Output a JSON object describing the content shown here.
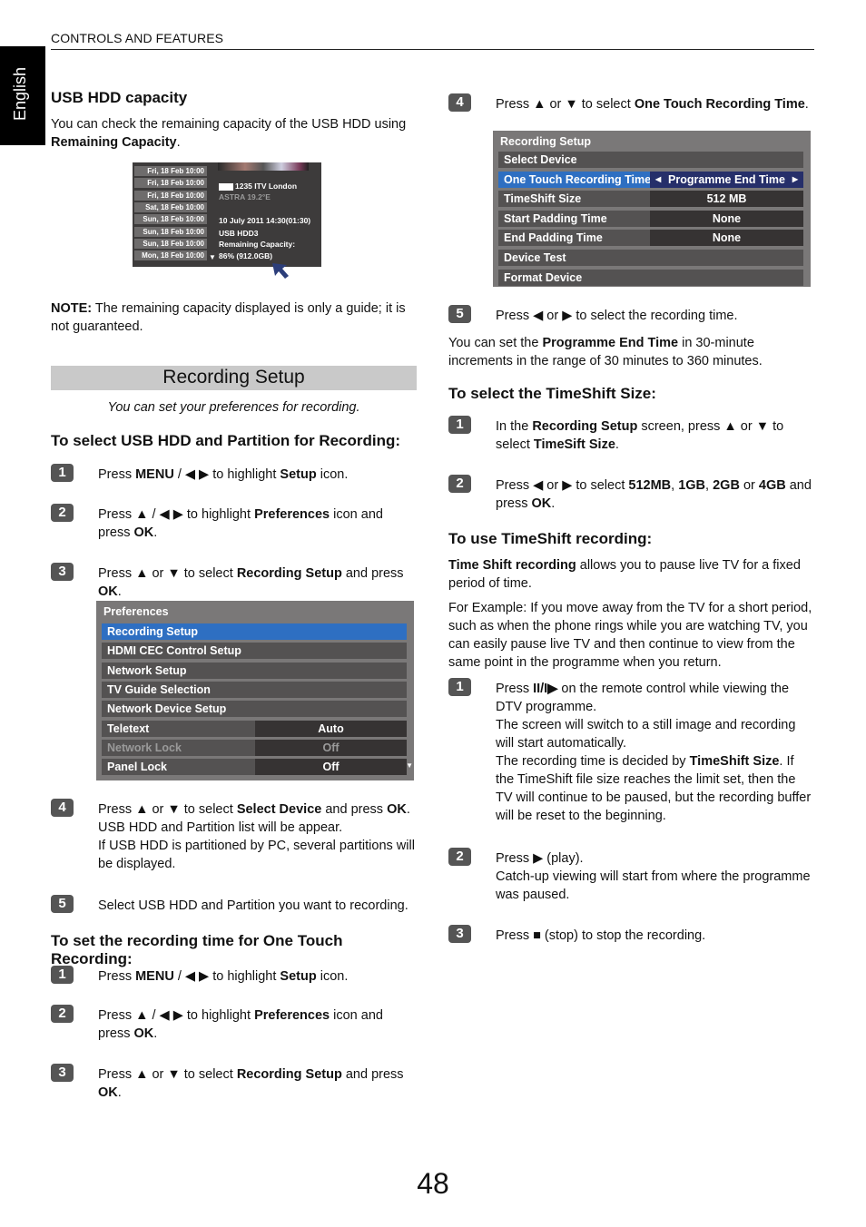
{
  "header": {
    "section": "CONTROLS AND FEATURES",
    "language_tab": "English"
  },
  "page_number": "48",
  "usb_hdd": {
    "title": "USB HDD capacity",
    "intro": [
      [
        "You can check the remaining capacity of the USB HDD using ",
        0
      ],
      [
        "Remaining Capacity",
        1
      ],
      [
        ".",
        0
      ]
    ],
    "screenshot": {
      "dates": [
        "Fri, 18 Feb 10:00",
        "Fri, 18 Feb 10:00",
        "Fri, 18 Feb 10:00",
        "Sat, 18 Feb 10:00",
        "Sun, 18 Feb 10:00",
        "Sun, 18 Feb 10:00",
        "Sun, 18 Feb 10:00",
        "Mon, 18 Feb 10:00"
      ],
      "channel": "1235 ITV London",
      "satellite": "ASTRA 19.2°E",
      "datetime": "10 July 2011  14:30(01:30)",
      "device": "USB HDD3",
      "capacity_label": "Remaining Capacity:",
      "capacity_value": "86% (912.0GB)",
      "remaining_percent": 86
    },
    "note": [
      [
        "NOTE:",
        1
      ],
      [
        " The remaining capacity displayed is only a guide; it is not guaranteed.",
        0
      ]
    ]
  },
  "recording_setup": {
    "banner": "Recording Setup",
    "subtitle": "You can set your preferences for recording."
  },
  "left": [
    {
      "type": "h",
      "text": "To select USB HDD and Partition for Recording:"
    },
    {
      "type": "step",
      "n": "1",
      "paras": [
        [
          [
            "Press ",
            0
          ],
          [
            "MENU",
            1
          ],
          [
            " / ◀ ▶ to highlight ",
            0
          ],
          [
            "Setup",
            1
          ],
          [
            " icon.",
            0
          ]
        ]
      ]
    },
    {
      "type": "step",
      "n": "2",
      "paras": [
        [
          [
            "Press ▲ / ◀ ▶ to highlight ",
            0
          ],
          [
            "Preferences",
            1
          ],
          [
            " icon and press ",
            0
          ],
          [
            "OK",
            1
          ],
          [
            ".",
            0
          ]
        ]
      ]
    },
    {
      "type": "step",
      "n": "3",
      "paras": [
        [
          [
            "Press ▲ or ▼ to select ",
            0
          ],
          [
            "Recording Setup",
            1
          ],
          [
            " and press ",
            0
          ],
          [
            "OK",
            1
          ],
          [
            ".",
            0
          ]
        ]
      ]
    },
    {
      "type": "step",
      "n": "4",
      "paras": [
        [
          [
            "Press ▲ or ▼ to select ",
            0
          ],
          [
            "Select Device",
            1
          ],
          [
            " and press ",
            0
          ],
          [
            "OK",
            1
          ],
          [
            ".",
            0
          ]
        ],
        [
          [
            "USB HDD and Partition list will be appear.",
            0
          ]
        ],
        [
          [
            "If USB HDD is partitioned by PC, several partitions will be displayed.",
            0
          ]
        ]
      ]
    },
    {
      "type": "step",
      "n": "5",
      "paras": [
        [
          [
            "Select USB HDD and Partition you want to recording.",
            0
          ]
        ]
      ]
    },
    {
      "type": "h",
      "text": "To set the recording time for One Touch Recording:"
    },
    {
      "type": "step",
      "n": "1",
      "paras": [
        [
          [
            "Press ",
            0
          ],
          [
            "MENU",
            1
          ],
          [
            " / ◀ ▶ to highlight ",
            0
          ],
          [
            "Setup",
            1
          ],
          [
            " icon.",
            0
          ]
        ]
      ]
    },
    {
      "type": "step",
      "n": "2",
      "paras": [
        [
          [
            "Press ▲ / ◀ ▶ to highlight ",
            0
          ],
          [
            "Preferences",
            1
          ],
          [
            " icon and press ",
            0
          ],
          [
            "OK",
            1
          ],
          [
            ".",
            0
          ]
        ]
      ]
    },
    {
      "type": "step",
      "n": "3",
      "paras": [
        [
          [
            "Press ▲ or ▼ to select ",
            0
          ],
          [
            "Recording Setup",
            1
          ],
          [
            " and press ",
            0
          ],
          [
            "OK",
            1
          ],
          [
            ".",
            0
          ]
        ]
      ]
    }
  ],
  "right": [
    {
      "type": "step",
      "n": "4",
      "paras": [
        [
          [
            "Press ▲ or ▼ to select ",
            0
          ],
          [
            "One Touch Recording Time",
            1
          ],
          [
            ".",
            0
          ]
        ]
      ]
    },
    {
      "type": "step",
      "n": "5",
      "paras": [
        [
          [
            "Press ◀ or ▶ to select the recording time.",
            0
          ]
        ]
      ]
    },
    {
      "type": "p",
      "paras": [
        [
          [
            "You can set the ",
            0
          ],
          [
            "Programme End Time",
            1
          ],
          [
            " in 30-minute increments in the range of 30 minutes to 360 minutes.",
            0
          ]
        ]
      ]
    },
    {
      "type": "h",
      "text": "To select the TimeShift Size:"
    },
    {
      "type": "step",
      "n": "1",
      "paras": [
        [
          [
            "In the ",
            0
          ],
          [
            "Recording Setup",
            1
          ],
          [
            " screen, press ▲ or ▼ to select ",
            0
          ],
          [
            "TimeSift Size",
            1
          ],
          [
            ".",
            0
          ]
        ]
      ]
    },
    {
      "type": "step",
      "n": "2",
      "paras": [
        [
          [
            "Press ◀ or ▶ to select ",
            0
          ],
          [
            "512MB",
            1
          ],
          [
            ", ",
            0
          ],
          [
            "1GB",
            1
          ],
          [
            ", ",
            0
          ],
          [
            "2GB",
            1
          ],
          [
            " or ",
            0
          ],
          [
            "4GB",
            1
          ],
          [
            " and press ",
            0
          ],
          [
            "OK",
            1
          ],
          [
            ".",
            0
          ]
        ]
      ]
    },
    {
      "type": "h",
      "text": "To use TimeShift recording:"
    },
    {
      "type": "p",
      "paras": [
        [
          [
            "Time Shift recording",
            1
          ],
          [
            " allows you to pause live TV for a fixed period of time.",
            0
          ]
        ]
      ]
    },
    {
      "type": "p",
      "paras": [
        [
          [
            "For Example: If you move away from the TV for a short period, such as when the phone rings while you are watching TV, you can easily pause live TV and then continue to view from the same point in the programme when you return.",
            0
          ]
        ]
      ]
    },
    {
      "type": "step",
      "n": "1",
      "paras": [
        [
          [
            "Press ",
            0
          ],
          [
            "II/I▶",
            1
          ],
          [
            "  on the remote control while viewing the DTV programme.",
            0
          ]
        ],
        [
          [
            "The screen will switch to a still image and recording will start automatically.",
            0
          ]
        ],
        [
          [
            "The recording time is decided by ",
            0
          ],
          [
            "TimeShift Size",
            1
          ],
          [
            ". If the TimeShift file size reaches the limit set, then the TV will continue to be paused, but the recording buffer will be reset to the beginning.",
            0
          ]
        ]
      ]
    },
    {
      "type": "step",
      "n": "2",
      "paras": [
        [
          [
            "Press ▶ (play).",
            0
          ]
        ],
        [
          [
            "Catch-up viewing will start from where the programme was paused.",
            0
          ]
        ]
      ]
    },
    {
      "type": "step",
      "n": "3",
      "paras": [
        [
          [
            "Press ■ (stop) to stop the recording.",
            0
          ]
        ]
      ]
    }
  ],
  "menus": {
    "preferences": {
      "title": "Preferences",
      "rows": [
        {
          "label": "Recording Setup",
          "selected": true
        },
        {
          "label": "HDMI CEC Control Setup"
        },
        {
          "label": "Network Setup"
        },
        {
          "label": "TV Guide Selection"
        },
        {
          "label": "Network Device Setup"
        },
        {
          "label": "Teletext",
          "value": "Auto"
        },
        {
          "label": "Network Lock",
          "value": "Off",
          "dim": true
        },
        {
          "label": "Panel Lock",
          "value": "Off"
        }
      ]
    },
    "recording": {
      "title": "Recording Setup",
      "rows": [
        {
          "label": "Select Device"
        },
        {
          "label": "One Touch Recording Time",
          "value": "Programme End Time",
          "selected": true
        },
        {
          "label": "TimeShift Size",
          "value": "512 MB"
        },
        {
          "label": "Start Padding Time",
          "value": "None"
        },
        {
          "label": "End Padding Time",
          "value": "None"
        },
        {
          "label": "Device Test"
        },
        {
          "label": "Format Device"
        }
      ]
    }
  },
  "colors": {
    "selected_row": "#2e6fc2",
    "selected_value": "#262f6a",
    "menu_bg": "#7a7878",
    "badge": "#555555",
    "banner": "#c9c9c9"
  }
}
